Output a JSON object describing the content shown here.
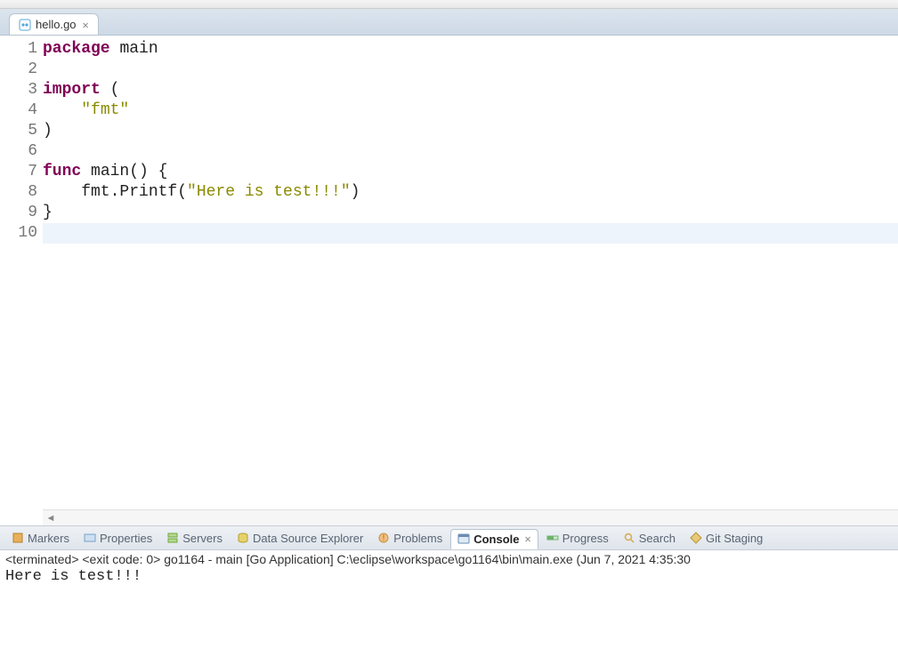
{
  "editor": {
    "tab_label": "hello.go",
    "lines": [
      {
        "n": "1",
        "html": "<span class='kw'>package</span> <span class='ident'>main</span>"
      },
      {
        "n": "2",
        "html": ""
      },
      {
        "n": "3",
        "html": "<span class='kw'>import</span> ("
      },
      {
        "n": "4",
        "html": "    <span class='str'>\"fmt\"</span>"
      },
      {
        "n": "5",
        "html": ")"
      },
      {
        "n": "6",
        "html": ""
      },
      {
        "n": "7",
        "html": "<span class='kw'>func</span> <span class='ident'>main</span>() {"
      },
      {
        "n": "8",
        "html": "    fmt.Printf(<span class='str'>\"Here is test!!!\"</span>)"
      },
      {
        "n": "9",
        "html": "}"
      },
      {
        "n": "10",
        "html": "",
        "current": true
      }
    ]
  },
  "panel_tabs": {
    "markers": "Markers",
    "properties": "Properties",
    "servers": "Servers",
    "dse": "Data Source Explorer",
    "problems": "Problems",
    "console": "Console",
    "progress": "Progress",
    "search": "Search",
    "git": "Git Staging"
  },
  "console": {
    "status": "<terminated> <exit code: 0> go1164 - main [Go Application] C:\\eclipse\\workspace\\go1164\\bin\\main.exe (Jun 7, 2021 4:35:30",
    "output": "Here is test!!!"
  }
}
